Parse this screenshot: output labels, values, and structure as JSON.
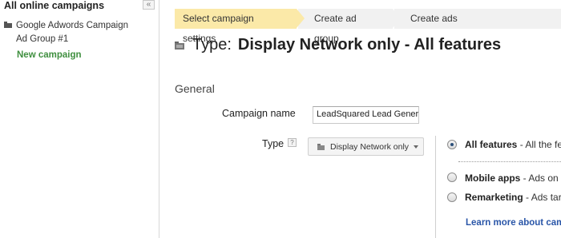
{
  "sidebar": {
    "title": "All online campaigns",
    "collapse_glyph": "«",
    "campaign_name": "Google Adwords Campaign",
    "ad_group": "Ad Group #1",
    "new_campaign": "New campaign"
  },
  "steps": [
    {
      "label": "Select campaign settings",
      "active": true
    },
    {
      "label": "Create ad group",
      "active": false
    },
    {
      "label": "Create ads",
      "active": false
    }
  ],
  "header": {
    "prefix": "Type:",
    "title": "Display Network only - All features"
  },
  "general": {
    "section_label": "General",
    "campaign_name_label": "Campaign name",
    "campaign_name_value": "LeadSquared Lead Gener",
    "type_label": "Type",
    "help_glyph": "?",
    "type_selected": "Display Network only"
  },
  "options": [
    {
      "name": "All features",
      "desc": " - All the fe",
      "checked": true
    },
    {
      "name": "Mobile apps",
      "desc": " - Ads on",
      "checked": false
    },
    {
      "name": "Remarketing",
      "desc": " - Ads tar",
      "checked": false
    }
  ],
  "learn_more": "Learn more about cam",
  "colors": {
    "active_step": "#fbe9a8",
    "inactive_step": "#f1f1f1",
    "new_campaign_green": "#3f8f3f",
    "link_blue": "#2a56a8"
  },
  "icons": {
    "folder": "folder-icon",
    "collapse": "double-chevron-left-icon",
    "help": "help-icon",
    "dropdown": "chevron-down-icon"
  }
}
